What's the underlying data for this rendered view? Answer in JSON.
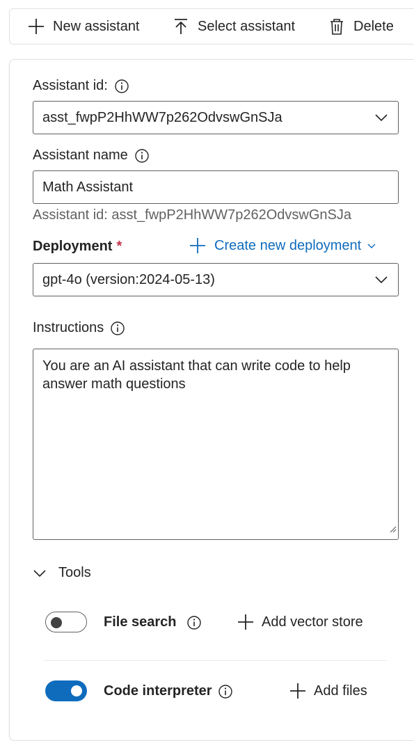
{
  "toolbar": {
    "new_label": "New assistant",
    "select_label": "Select assistant",
    "delete_label": "Delete"
  },
  "form": {
    "assistant_id_label": "Assistant id:",
    "assistant_id_value": "asst_fwpP2HhWW7p262OdvswGnSJa",
    "assistant_name_label": "Assistant name",
    "assistant_name_value": "Math Assistant",
    "assistant_id_hint": "Assistant id: asst_fwpP2HhWW7p262OdvswGnSJa",
    "deployment_label": "Deployment",
    "required_mark": "*",
    "create_deployment_label": "Create new deployment",
    "deployment_value": "gpt-4o (version:2024-05-13)",
    "instructions_label": "Instructions",
    "instructions_value": "You are an AI assistant that can write code to help answer math questions"
  },
  "tools": {
    "header": "Tools",
    "items": [
      {
        "name": "File search",
        "enabled": false,
        "action": "Add vector store"
      },
      {
        "name": "Code interpreter",
        "enabled": true,
        "action": "Add files"
      }
    ]
  },
  "colors": {
    "accent": "#0f6cbd",
    "required": "#c4314b",
    "text": "#242424",
    "hint": "#616161"
  }
}
